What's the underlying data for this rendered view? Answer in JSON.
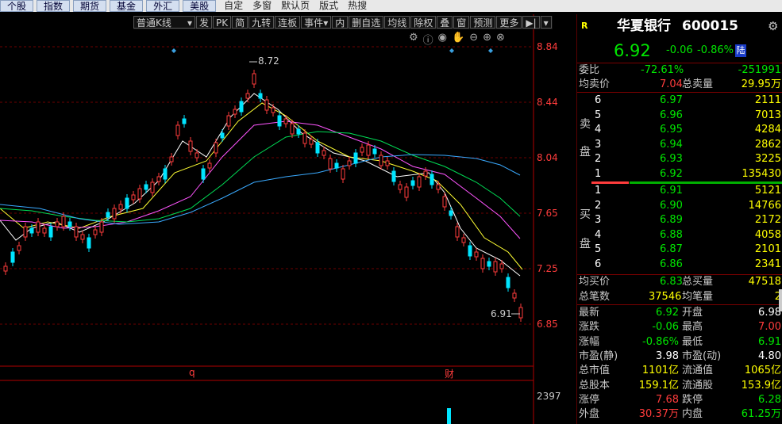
{
  "top_tabs": [
    "个股",
    "指数",
    "期货",
    "基金",
    "外汇",
    "美股"
  ],
  "top_links": [
    "自定",
    "多窗",
    "默认页",
    "版式",
    "热搜"
  ],
  "toolbar": {
    "kline_type": "普通K线",
    "buttons": [
      "发",
      "PK",
      "简",
      "九转",
      "连板",
      "事件",
      "内",
      "删自选",
      "均线",
      "除权",
      "叠",
      "窗",
      "预测",
      "更多"
    ]
  },
  "icons": [
    "settings-icon",
    "info-icon",
    "eye-icon",
    "hand-icon",
    "minus-circle-icon",
    "plus-circle-icon",
    "close-circle-icon"
  ],
  "price_axis": [
    "8.84",
    "8.44",
    "8.04",
    "7.65",
    "7.25",
    "6.85"
  ],
  "volume_axis": "2397",
  "chart_labels": {
    "high": "8.72",
    "low": "6.91",
    "event_q": "q",
    "event_cai": "财"
  },
  "chart_data": {
    "type": "candlestick",
    "x": [],
    "high_label": 8.72,
    "low_label": 6.91,
    "ylim": [
      6.85,
      8.84
    ]
  },
  "stock": {
    "name": "华夏银行",
    "code": "600015",
    "badge": "R",
    "price": "6.92",
    "change": "-0.06",
    "pct": "-0.86%",
    "market": "陆"
  },
  "summary": {
    "ratio_label": "委比",
    "ratio": "-72.61%",
    "diff": "-251991",
    "avg_ask_label": "均卖价",
    "avg_ask": "7.04",
    "total_ask_label": "总卖量",
    "total_ask": "29.95万"
  },
  "sell_side_label": [
    "卖",
    "盘"
  ],
  "buy_side_label": [
    "买",
    "盘"
  ],
  "asks": [
    {
      "lvl": "6",
      "price": "6.97",
      "vol": "2111"
    },
    {
      "lvl": "5",
      "price": "6.96",
      "vol": "7013"
    },
    {
      "lvl": "4",
      "price": "6.95",
      "vol": "4284"
    },
    {
      "lvl": "3",
      "price": "6.94",
      "vol": "2862"
    },
    {
      "lvl": "2",
      "price": "6.93",
      "vol": "3225"
    },
    {
      "lvl": "1",
      "price": "6.92",
      "vol": "135430"
    }
  ],
  "bids": [
    {
      "lvl": "1",
      "price": "6.91",
      "vol": "5121"
    },
    {
      "lvl": "2",
      "price": "6.90",
      "vol": "14766"
    },
    {
      "lvl": "3",
      "price": "6.89",
      "vol": "2172"
    },
    {
      "lvl": "4",
      "price": "6.88",
      "vol": "4058"
    },
    {
      "lvl": "5",
      "price": "6.87",
      "vol": "2101"
    },
    {
      "lvl": "6",
      "price": "6.86",
      "vol": "2341"
    }
  ],
  "bid_summary": {
    "avg_bid_label": "均买价",
    "avg_bid": "6.83",
    "total_bid_label": "总买量",
    "total_bid": "47518"
  },
  "counts": {
    "trades_label": "总笔数",
    "trades": "37546",
    "avg_label": "均笔量",
    "avg": "2"
  },
  "stats": [
    {
      "l1": "最新",
      "v1": "6.92",
      "c1": "green",
      "l2": "开盘",
      "v2": "6.98",
      "c2": "wh"
    },
    {
      "l1": "涨跌",
      "v1": "-0.06",
      "c1": "green",
      "l2": "最高",
      "v2": "7.00",
      "c2": "red"
    },
    {
      "l1": "涨幅",
      "v1": "-0.86%",
      "c1": "green",
      "l2": "最低",
      "v2": "6.91",
      "c2": "green"
    },
    {
      "l1": "市盈(静)",
      "v1": "3.98",
      "c1": "wh",
      "l2": "市盈(动)",
      "v2": "4.80",
      "c2": "wh"
    },
    {
      "l1": "总市值",
      "v1": "1101亿",
      "c1": "yel",
      "l2": "流通值",
      "v2": "1065亿",
      "c2": "yel"
    },
    {
      "l1": "总股本",
      "v1": "159.1亿",
      "c1": "yel",
      "l2": "流通股",
      "v2": "153.9亿",
      "c2": "yel"
    },
    {
      "l1": "涨停",
      "v1": "7.68",
      "c1": "red",
      "l2": "跌停",
      "v2": "6.28",
      "c2": "green"
    },
    {
      "l1": "外盘",
      "v1": "30.37万",
      "c1": "red",
      "l2": "内盘",
      "v2": "61.25万",
      "c2": "green"
    }
  ]
}
